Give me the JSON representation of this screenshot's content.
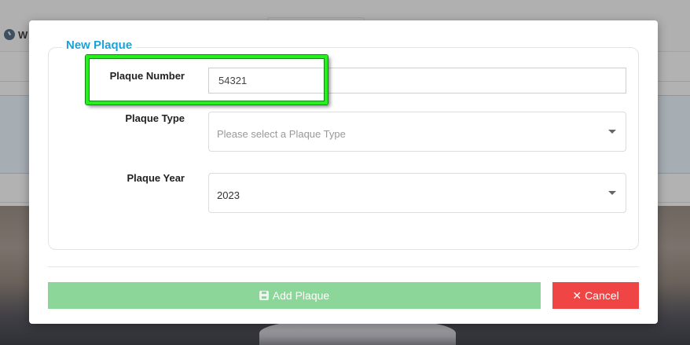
{
  "background": {
    "header_initial": "W"
  },
  "modal": {
    "legend": "New Plaque",
    "fields": {
      "plaque_number": {
        "label": "Plaque Number",
        "value": "54321"
      },
      "plaque_type": {
        "label": "Plaque Type",
        "placeholder": "Please select a Plaque Type"
      },
      "plaque_year": {
        "label": "Plaque Year",
        "value": "2023"
      }
    },
    "buttons": {
      "add": {
        "label": "Add Plaque",
        "icon": "save-icon",
        "color": "#8dd699"
      },
      "cancel": {
        "label": "Cancel",
        "icon": "close-icon",
        "icon_glyph": "✕",
        "color": "#f04545"
      }
    },
    "accent_color": "#1aa3d8",
    "highlight_color": "#23f01d"
  }
}
